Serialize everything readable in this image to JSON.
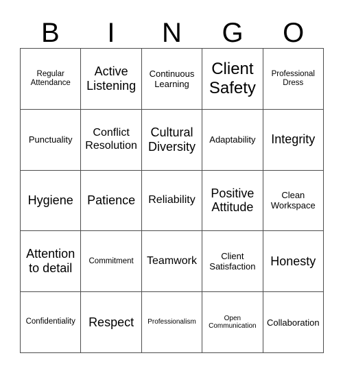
{
  "card": {
    "title": "BINGO",
    "header_letters": [
      "B",
      "I",
      "N",
      "G",
      "O"
    ],
    "grid_size": "5x5",
    "border_color": "#4d4d4d",
    "background_color": "#ffffff",
    "text_color": "#000000"
  },
  "cells": [
    {
      "text": "Regular\nAttendance",
      "size": "fs-sm"
    },
    {
      "text": "Active\nListening",
      "size": "fs-xl"
    },
    {
      "text": "Continuous\nLearning",
      "size": "fs-md"
    },
    {
      "text": "Client\nSafety",
      "size": "fs-xxl"
    },
    {
      "text": "Professional\nDress",
      "size": "fs-sm"
    },
    {
      "text": "Punctuality",
      "size": "fs-md"
    },
    {
      "text": "Conflict\nResolution",
      "size": "fs-lg"
    },
    {
      "text": "Cultural\nDiversity",
      "size": "fs-xl"
    },
    {
      "text": "Adaptability",
      "size": "fs-md"
    },
    {
      "text": "Integrity",
      "size": "fs-xl"
    },
    {
      "text": "Hygiene",
      "size": "fs-xl"
    },
    {
      "text": "Patience",
      "size": "fs-xl"
    },
    {
      "text": "Reliability",
      "size": "fs-lg"
    },
    {
      "text": "Positive\nAttitude",
      "size": "fs-xl"
    },
    {
      "text": "Clean\nWorkspace",
      "size": "fs-md"
    },
    {
      "text": "Attention\nto detail",
      "size": "fs-xl"
    },
    {
      "text": "Commitment",
      "size": "fs-sm"
    },
    {
      "text": "Teamwork",
      "size": "fs-lg"
    },
    {
      "text": "Client\nSatisfaction",
      "size": "fs-md"
    },
    {
      "text": "Honesty",
      "size": "fs-xl"
    },
    {
      "text": "Confidentiality",
      "size": "fs-sm"
    },
    {
      "text": "Respect",
      "size": "fs-xl"
    },
    {
      "text": "Professionalism",
      "size": "fs-xs"
    },
    {
      "text": "Open\nCommunication",
      "size": "fs-xs"
    },
    {
      "text": "Collaboration",
      "size": "fs-md"
    }
  ]
}
